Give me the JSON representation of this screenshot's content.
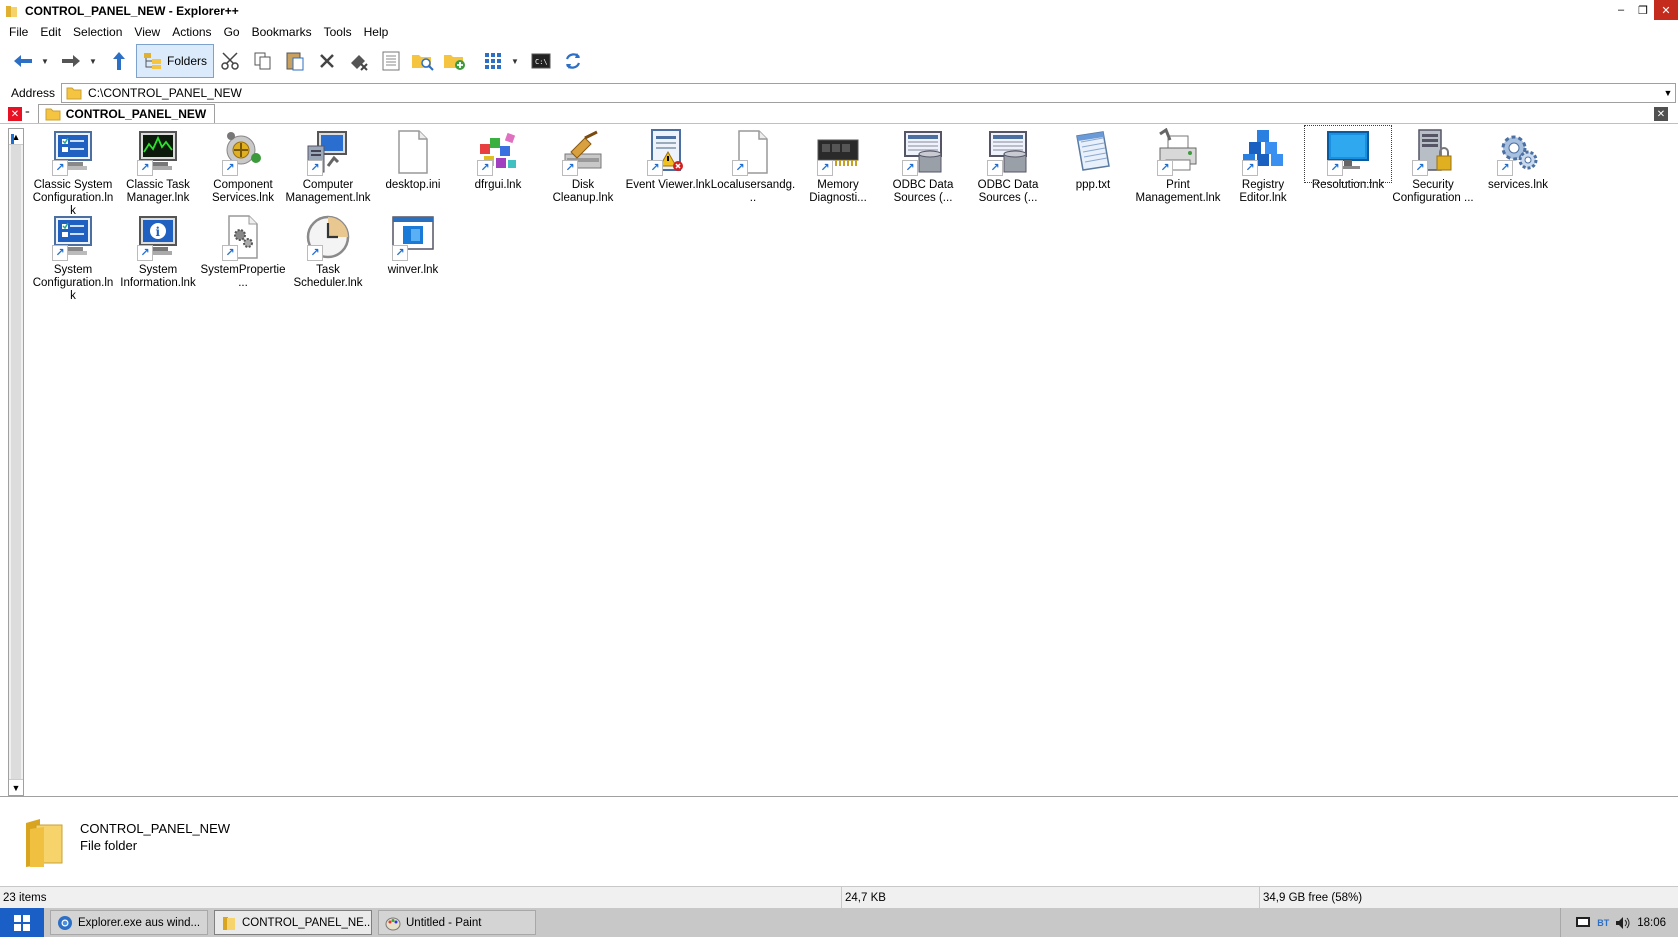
{
  "window": {
    "title": "CONTROL_PANEL_NEW - Explorer++",
    "minimize_glyph": "–",
    "restore_glyph": "❐",
    "close_glyph": "✕"
  },
  "menu": {
    "items": [
      "File",
      "Edit",
      "Selection",
      "View",
      "Actions",
      "Go",
      "Bookmarks",
      "Tools",
      "Help"
    ]
  },
  "toolbar": {
    "folders_label": "Folders"
  },
  "address": {
    "label": "Address",
    "value": "C:\\CONTROL_PANEL_NEW"
  },
  "tabs": {
    "active_label": "CONTROL_PANEL_NEW"
  },
  "files": [
    {
      "label": "Classic System Configuration.lnk",
      "icon": "msconfig-icon",
      "shortcut": true
    },
    {
      "label": "Classic Task Manager.lnk",
      "icon": "task-manager-icon",
      "shortcut": true
    },
    {
      "label": "Component Services.lnk",
      "icon": "component-services-icon",
      "shortcut": true
    },
    {
      "label": "Computer Management.lnk",
      "icon": "computer-management-icon",
      "shortcut": true
    },
    {
      "label": "desktop.ini",
      "icon": "blank-file-icon",
      "shortcut": false
    },
    {
      "label": "dfrgui.lnk",
      "icon": "defrag-icon",
      "shortcut": true
    },
    {
      "label": "Disk Cleanup.lnk",
      "icon": "disk-cleanup-icon",
      "shortcut": true
    },
    {
      "label": "Event Viewer.lnk",
      "icon": "event-viewer-icon",
      "shortcut": true
    },
    {
      "label": "Localusersandg...",
      "icon": "blank-file-icon",
      "shortcut": true
    },
    {
      "label": "Memory Diagnosti...",
      "icon": "memory-chip-icon",
      "shortcut": true
    },
    {
      "label": "ODBC Data Sources (...",
      "icon": "odbc-icon",
      "shortcut": true
    },
    {
      "label": "ODBC Data Sources (...",
      "icon": "odbc-icon",
      "shortcut": true
    },
    {
      "label": "ppp.txt",
      "icon": "notepad-icon",
      "shortcut": false
    },
    {
      "label": "Print Management.lnk",
      "icon": "printer-icon",
      "shortcut": true
    },
    {
      "label": "Registry Editor.lnk",
      "icon": "registry-icon",
      "shortcut": true
    },
    {
      "label": "Resolution.lnk",
      "icon": "monitor-icon",
      "shortcut": true,
      "selected": true
    },
    {
      "label": "Security Configuration ...",
      "icon": "security-server-icon",
      "shortcut": true
    },
    {
      "label": "services.lnk",
      "icon": "services-gears-icon",
      "shortcut": true
    },
    {
      "label": "System Configuration.lnk",
      "icon": "msconfig-icon",
      "shortcut": true
    },
    {
      "label": "System Information.lnk",
      "icon": "system-info-icon",
      "shortcut": true
    },
    {
      "label": "SystemPropertie...",
      "icon": "settings-file-icon",
      "shortcut": true
    },
    {
      "label": "Task Scheduler.lnk",
      "icon": "clock-icon",
      "shortcut": true
    },
    {
      "label": "winver.lnk",
      "icon": "winver-icon",
      "shortcut": true
    }
  ],
  "details": {
    "name": "CONTROL_PANEL_NEW",
    "type": "File folder"
  },
  "status": {
    "items": "23 items",
    "size": "24,7 KB",
    "free": "34,9 GB free (58%)"
  },
  "taskbar": {
    "items": [
      {
        "label": "Explorer.exe aus wind...",
        "icon": "chrome-icon"
      },
      {
        "label": "CONTROL_PANEL_NE...",
        "icon": "explorer-icon",
        "active": true
      },
      {
        "label": "Untitled - Paint",
        "icon": "paint-icon"
      }
    ],
    "clock": "18:06",
    "tray_bt": "BT"
  },
  "colors": {
    "accent": "#1a6fd0",
    "folder": "#f5c542",
    "close_red": "#c42b1c",
    "taskbar": "#c8c8c8"
  }
}
